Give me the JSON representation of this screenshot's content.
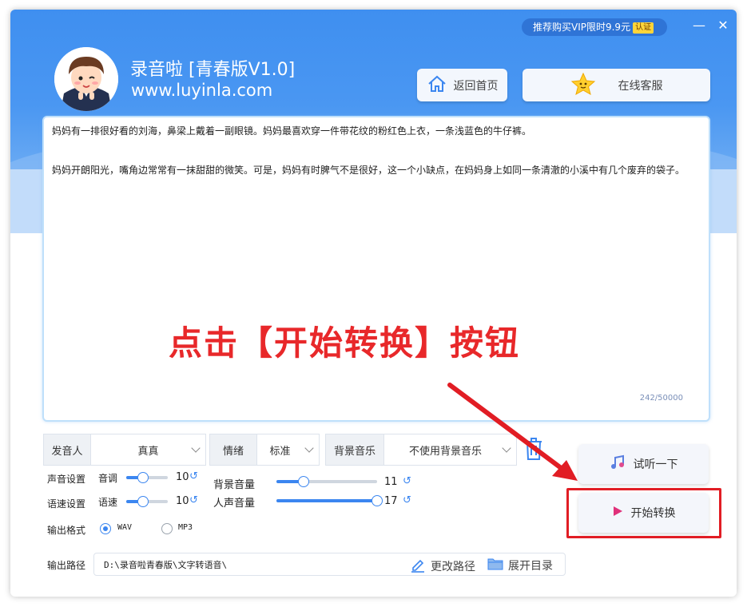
{
  "header": {
    "vip_text": "推荐购买VIP限时9.9元",
    "vip_tag": "认证",
    "title": "录音啦  [青春版V1.0]",
    "site": "www.luyinla.com",
    "home_button": "返回首页",
    "service_button": "在线客服",
    "minimize": "—",
    "close": "✕"
  },
  "editor": {
    "paragraphs": [
      "妈妈有一排很好看的刘海，鼻梁上戴着一副眼镜。妈妈最喜欢穿一件带花纹的粉红色上衣，一条浅蓝色的牛仔裤。",
      "妈妈开朗阳光，嘴角边常常有一抹甜甜的微笑。可是，妈妈有时脾气不是很好，这一个小缺点，在妈妈身上如同一条清澈的小溪中有几个废弃的袋子。"
    ],
    "counter": "242/50000"
  },
  "overlay_text": "点击【开始转换】按钮",
  "selects": {
    "speaker_label": "发音人",
    "speaker_value": "真真",
    "emotion_label": "情绪",
    "emotion_value": "标准",
    "bgm_label": "背景音乐",
    "bgm_value": "不使用背景音乐"
  },
  "settings": {
    "voice_settings": "声音设置",
    "pitch_label": "音调",
    "pitch_value": "10",
    "speed_settings": "语速设置",
    "speed_label": "语速",
    "speed_value": "10",
    "bg_volume_label": "背景音量",
    "bg_volume_value": "11",
    "voice_volume_label": "人声音量",
    "voice_volume_value": "17",
    "reset_glyph": "↺",
    "pitch_level": 0.4,
    "speed_level": 0.4,
    "bg_volume_level": 0.27,
    "voice_volume_level": 1.0
  },
  "output": {
    "format_label": "输出格式",
    "wav": "WAV",
    "mp3": "MP3",
    "path_label": "输出路径",
    "path_value": "D:\\录音啦青春版\\文字转语音\\",
    "change_path": "更改路径",
    "open_dir": "展开目录"
  },
  "actions": {
    "preview": "试听一下",
    "convert": "开始转换"
  },
  "colors": {
    "accent": "#3b86f0",
    "header": "#4a97f2",
    "highlight": "#e11d24"
  }
}
